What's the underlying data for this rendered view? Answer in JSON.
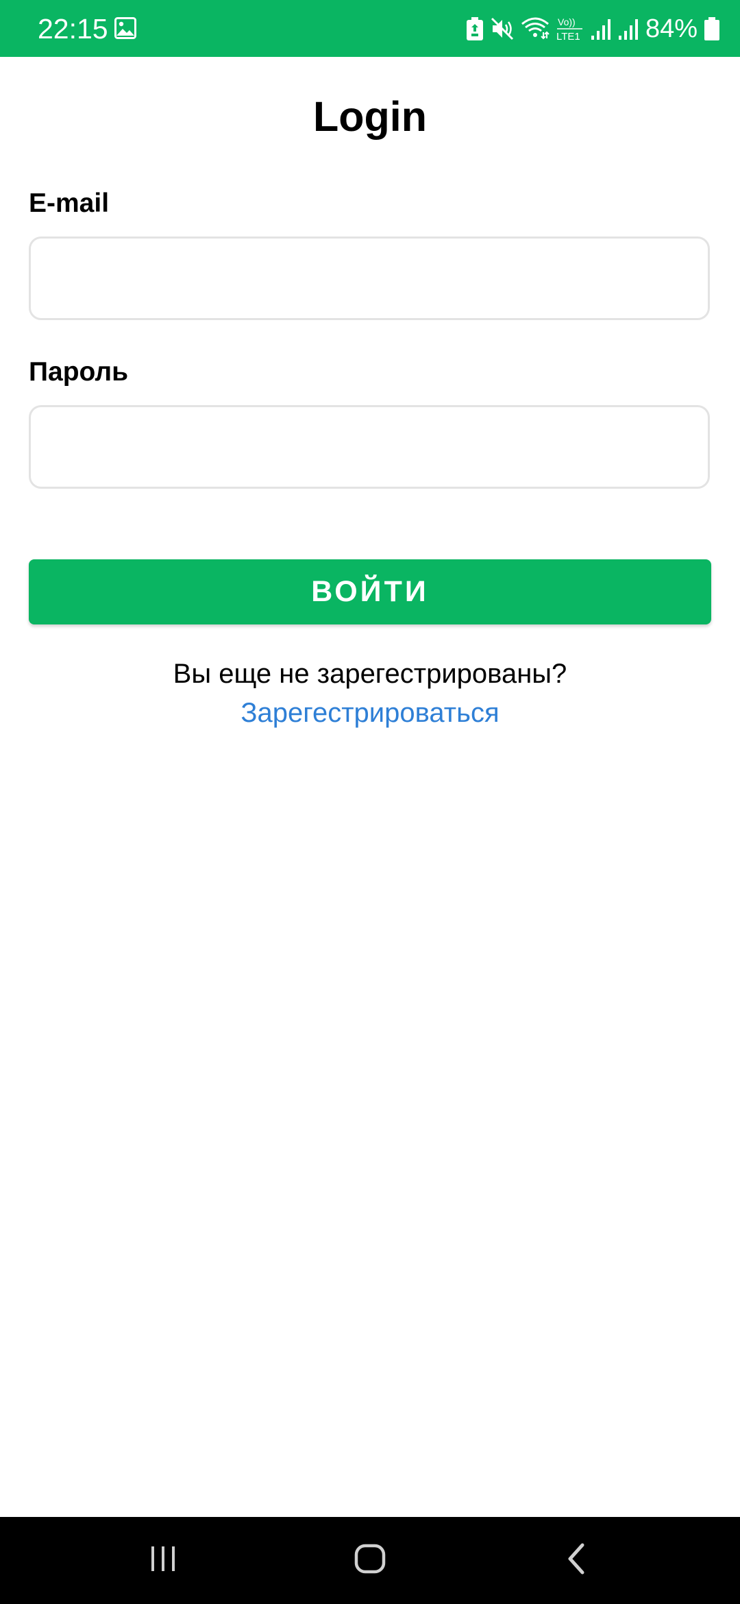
{
  "status_bar": {
    "time": "22:15",
    "battery_percent": "84%",
    "network_label_top": "Vo))",
    "network_label_bottom": "LTE1",
    "background_color": "#0ab562",
    "icons": [
      "gallery-icon",
      "battery-saver-icon",
      "mute-icon",
      "wifi-icon",
      "volte-icon",
      "signal-icon",
      "signal-icon-2",
      "battery-icon"
    ]
  },
  "page": {
    "title": "Login"
  },
  "form": {
    "email_label": "E-mail",
    "email_value": "",
    "password_label": "Пароль",
    "password_value": "",
    "login_button_label": "ВОЙТИ",
    "button_color": "#0ab562"
  },
  "register": {
    "question": "Вы еще не зарегестрированы?",
    "link_label": "Зарегестрироваться",
    "link_color": "#2e7fd6"
  },
  "nav_bar": {
    "icons": [
      "recents-icon",
      "home-icon",
      "back-icon"
    ]
  }
}
